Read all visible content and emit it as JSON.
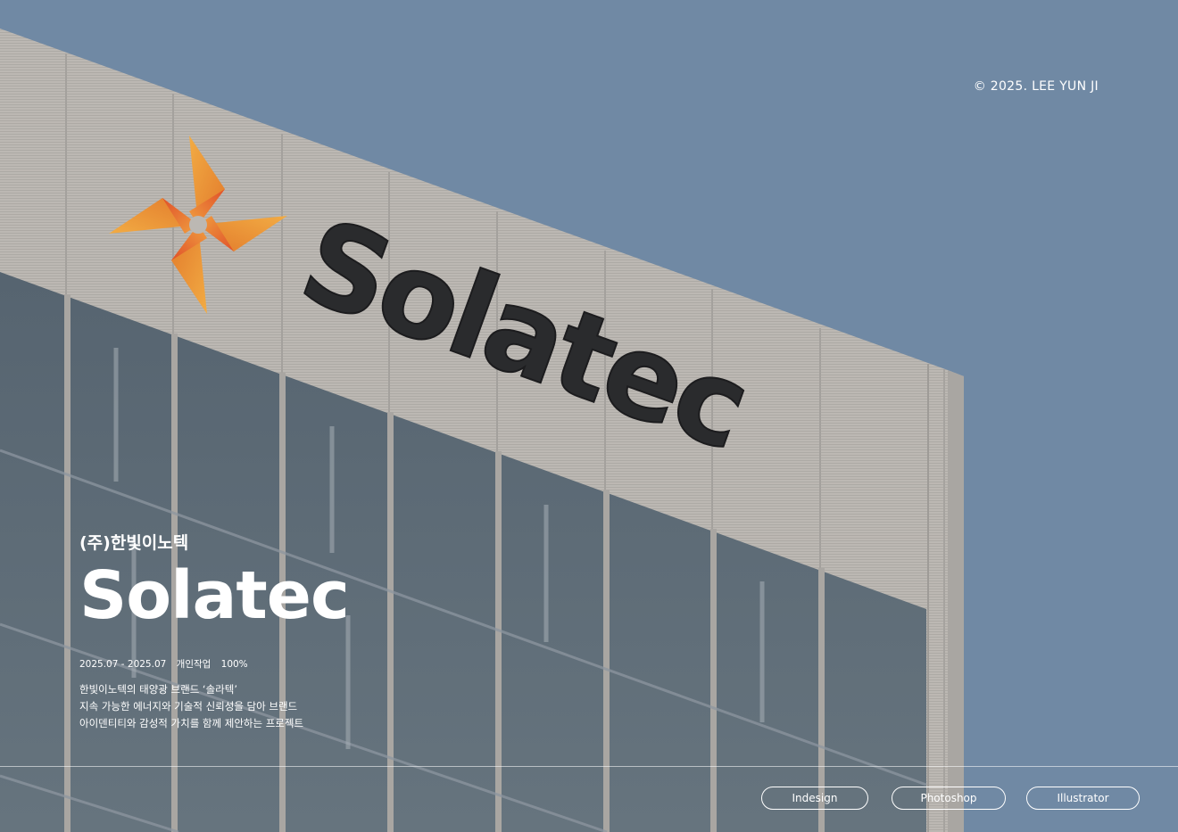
{
  "header": {
    "copyright": "© 2025. LEE YUN JI"
  },
  "sign": {
    "wordmark": "Solatec",
    "logo_icon": "pinwheel-sun-icon",
    "logo_colors": [
      "#f0a63c",
      "#e37a2b",
      "#d24a2a"
    ]
  },
  "project": {
    "company": "(주)한빛이노텍",
    "title": "Solatec",
    "period": "2025.07 - 2025.07",
    "type": "개인작업",
    "contribution": "100%",
    "description": [
      "한빛이노텍의 태양광 브랜드 ‘솔라텍’",
      "지속 가능한 에너지와 기술적 신뢰성을 담아 브랜드",
      "아이덴티티와 감성적 가치를 함께 제안하는 프로젝트"
    ]
  },
  "tools": [
    {
      "label": "Indesign"
    },
    {
      "label": "Photoshop"
    },
    {
      "label": "Illustrator"
    }
  ],
  "colors": {
    "sky": "#7089a4",
    "facade": "#b9b5b1",
    "glass": "#5c6a75",
    "text": "#ffffff"
  }
}
